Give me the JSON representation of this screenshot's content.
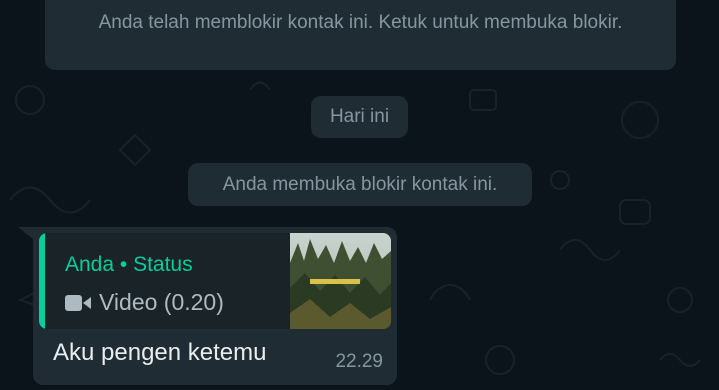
{
  "notices": {
    "blocked": "Anda telah memblokir kontak ini. Ketuk untuk membuka blokir.",
    "date": "Hari ini",
    "unblocked": "Anda membuka blokir kontak ini."
  },
  "message": {
    "quote": {
      "author": "Anda • Status",
      "media_label": "Video (0.20)",
      "media_icon": "video-camera-icon",
      "accent_color": "#06cf9c"
    },
    "text": "Aku pengen ketemu",
    "time": "22.29"
  }
}
